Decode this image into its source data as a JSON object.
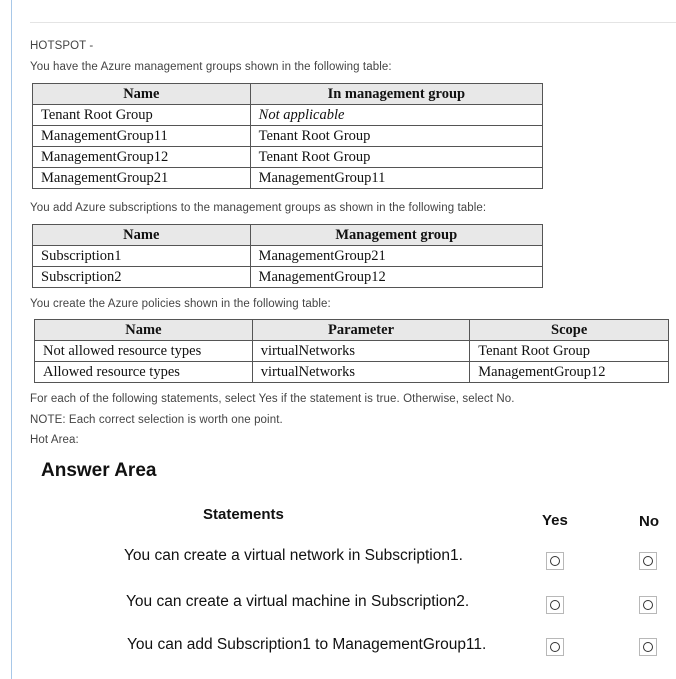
{
  "intro": {
    "hotspot": "HOTSPOT -",
    "line1": "You have the Azure management groups shown in the following table:",
    "line2": "You add Azure subscriptions to the management groups as shown in the following table:",
    "line3": "You create the Azure policies shown in the following table:",
    "instruction": "For each of the following statements, select Yes if the statement is true. Otherwise, select No.",
    "note": "NOTE: Each correct selection is worth one point.",
    "hot_area": "Hot Area:"
  },
  "table_groups": {
    "headers": [
      "Name",
      "In management group"
    ],
    "rows": [
      [
        "Tenant Root Group",
        "Not applicable"
      ],
      [
        "ManagementGroup11",
        "Tenant Root Group"
      ],
      [
        "ManagementGroup12",
        "Tenant Root Group"
      ],
      [
        "ManagementGroup21",
        "ManagementGroup11"
      ]
    ]
  },
  "table_subscriptions": {
    "headers": [
      "Name",
      "Management group"
    ],
    "rows": [
      [
        "Subscription1",
        "ManagementGroup21"
      ],
      [
        "Subscription2",
        "ManagementGroup12"
      ]
    ]
  },
  "table_policies": {
    "headers": [
      "Name",
      "Parameter",
      "Scope"
    ],
    "rows": [
      [
        "Not allowed resource types",
        "virtualNetworks",
        "Tenant Root Group"
      ],
      [
        "Allowed resource types",
        "virtualNetworks",
        "ManagementGroup12"
      ]
    ]
  },
  "answer_area": {
    "title": "Answer Area",
    "statements_header": "Statements",
    "yes_header": "Yes",
    "no_header": "No",
    "statements": [
      "You can create a virtual network in Subscription1.",
      "You can create a virtual machine in Subscription2.",
      "You can add Subscription1 to ManagementGroup11."
    ]
  }
}
